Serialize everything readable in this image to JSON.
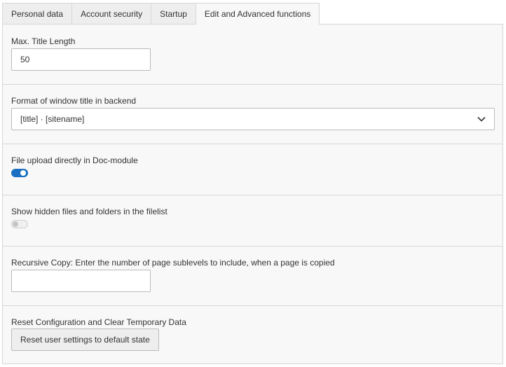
{
  "tabs": [
    {
      "label": "Personal data",
      "active": false
    },
    {
      "label": "Account security",
      "active": false
    },
    {
      "label": "Startup",
      "active": false
    },
    {
      "label": "Edit and Advanced functions",
      "active": true
    }
  ],
  "settings": {
    "max_title_length": {
      "label": "Max. Title Length",
      "value": "50"
    },
    "window_title_format": {
      "label": "Format of window title in backend",
      "selected": "[title] · [sitename]",
      "icon": "chevron-down-icon"
    },
    "file_upload_doc_module": {
      "label": "File upload directly in Doc-module",
      "enabled": true
    },
    "show_hidden_files": {
      "label": "Show hidden files and folders in the filelist",
      "enabled": false
    },
    "recursive_copy": {
      "label": "Recursive Copy: Enter the number of page sublevels to include, when a page is copied",
      "value": ""
    },
    "reset": {
      "label": "Reset Configuration and Clear Temporary Data",
      "button_label": "Reset user settings to default state"
    }
  },
  "colors": {
    "toggle_on": "#1a6fc2",
    "panel_background": "#f8f8f8",
    "border": "#d7d7d7"
  }
}
